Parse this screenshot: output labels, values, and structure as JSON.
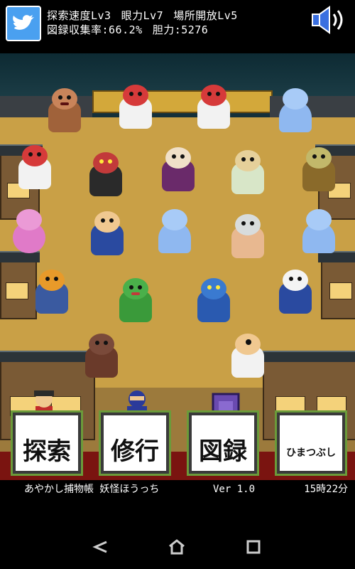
{
  "hud": {
    "stats_row1": [
      "探索速度Lv3",
      "眼力Lv7",
      "場所開放Lv5"
    ],
    "stats_row2": [
      "図録収集率:66.2%",
      "胆力:5276"
    ]
  },
  "menu": [
    {
      "label": "探索"
    },
    {
      "label": "修行"
    },
    {
      "label": "図録"
    },
    {
      "label": "ひまつぶし"
    }
  ],
  "status_bar": {
    "title": "あやかし捕物帳 妖怪ほうっち",
    "version": "Ver 1.0",
    "clock": "15時22分"
  },
  "colors": {
    "ground": "#c9a046",
    "red_floor": "#7a1410",
    "menu_border": "#6b9b3a",
    "twitter": "#4aa0f0"
  },
  "icons": [
    "twitter-icon",
    "speaker-icon",
    "back-icon",
    "home-icon",
    "recents-icon"
  ]
}
